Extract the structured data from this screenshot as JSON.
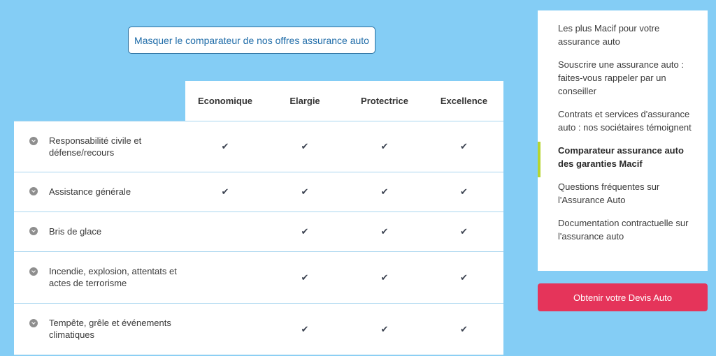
{
  "toggle_button": {
    "label": "Masquer le comparateur de nos offres assurance auto"
  },
  "table": {
    "columns": [
      "Economique",
      "Elargie",
      "Protectrice",
      "Excellence"
    ],
    "rows": [
      {
        "label": "Responsabilité civile et défense/recours",
        "marks": [
          true,
          true,
          true,
          true
        ]
      },
      {
        "label": "Assistance générale",
        "marks": [
          true,
          true,
          true,
          true
        ]
      },
      {
        "label": "Bris de glace",
        "marks": [
          false,
          true,
          true,
          true
        ]
      },
      {
        "label": "Incendie, explosion, attentats et actes de terrorisme",
        "marks": [
          false,
          true,
          true,
          true
        ]
      },
      {
        "label": "Tempête, grêle et événements climatiques",
        "marks": [
          false,
          true,
          true,
          true
        ]
      }
    ],
    "check_glyph": "✔",
    "expand_icon": "chevron-down-icon"
  },
  "sidebar": {
    "items": [
      {
        "label": "Les plus Macif pour votre assurance auto",
        "active": false
      },
      {
        "label": "Souscrire une assurance auto : faites-vous rappeler par un conseiller",
        "active": false
      },
      {
        "label": "Contrats et services d'assurance auto : nos sociétaires témoignent",
        "active": false
      },
      {
        "label": "Comparateur assurance auto des garanties Macif",
        "active": true
      },
      {
        "label": "Questions fréquentes sur l'Assurance Auto",
        "active": false
      },
      {
        "label": "Documentation contractuelle sur l'assurance auto",
        "active": false
      }
    ]
  },
  "devis_button": {
    "label": "Obtenir votre Devis Auto"
  },
  "colors": {
    "background": "#84cdf5",
    "accent_active": "#b6d530",
    "cta": "#e5345a",
    "link": "#1f6ca8"
  }
}
